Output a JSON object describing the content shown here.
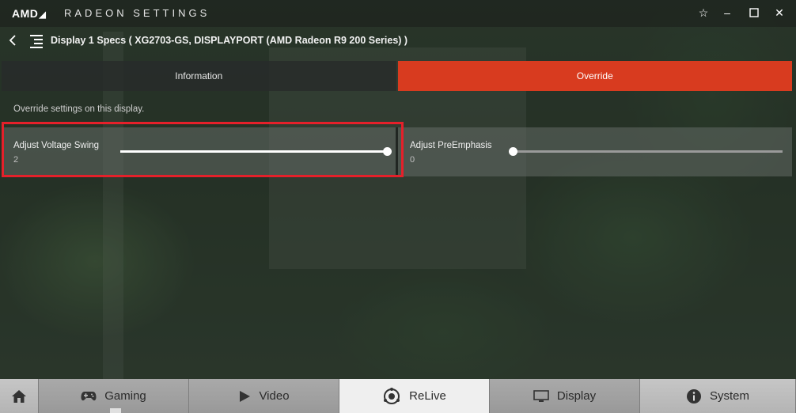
{
  "titlebar": {
    "brand": "AMD",
    "app_title": "RADEON SETTINGS"
  },
  "header": {
    "title": "Display 1 Specs ( XG2703-GS, DISPLAYPORT (AMD Radeon R9 200 Series) )"
  },
  "tabs": [
    {
      "label": "Information",
      "active": false
    },
    {
      "label": "Override",
      "active": true
    }
  ],
  "subtitle": "Override settings on this display.",
  "sliders": [
    {
      "label": "Adjust Voltage Swing",
      "value": "2",
      "fraction": 1.0
    },
    {
      "label": "Adjust PreEmphasis",
      "value": "0",
      "fraction": 0.0
    }
  ],
  "nav": [
    {
      "label": "",
      "icon": "home-icon"
    },
    {
      "label": "Gaming",
      "icon": "gamepad-icon"
    },
    {
      "label": "Video",
      "icon": "play-icon"
    },
    {
      "label": "ReLive",
      "icon": "relive-icon"
    },
    {
      "label": "Display",
      "icon": "monitor-icon"
    },
    {
      "label": "System",
      "icon": "info-icon"
    }
  ],
  "colors": {
    "accent": "#d83b1f",
    "highlight_border": "#e5202a"
  }
}
